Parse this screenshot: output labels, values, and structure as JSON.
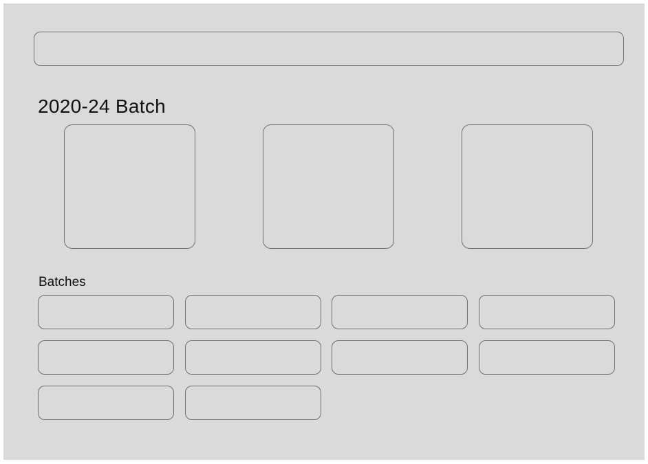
{
  "search": {
    "placeholder": ""
  },
  "featured": {
    "title": "2020-24 Batch",
    "cards": [
      "",
      "",
      ""
    ]
  },
  "batches": {
    "title": "Batches",
    "tiles": [
      "",
      "",
      "",
      "",
      "",
      "",
      "",
      "",
      "",
      ""
    ]
  },
  "colors": {
    "background": "#dadada",
    "border": "#6f6f6f",
    "text": "#111111"
  }
}
